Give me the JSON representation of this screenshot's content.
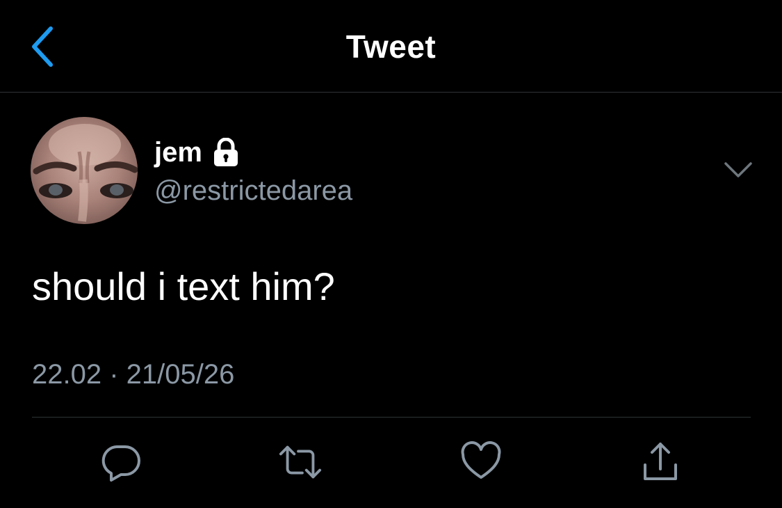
{
  "header": {
    "title": "Tweet",
    "back_icon": "chevron-left-icon"
  },
  "tweet": {
    "author": {
      "display_name": "jem",
      "handle": "@restrictedarea",
      "protected_icon": "lock-icon"
    },
    "text": "should i text him?",
    "timestamp": "22.02 · 21/05/26"
  },
  "actions": [
    {
      "name": "reply",
      "icon": "reply-icon"
    },
    {
      "name": "retweet",
      "icon": "retweet-icon"
    },
    {
      "name": "like",
      "icon": "heart-icon"
    },
    {
      "name": "share",
      "icon": "share-icon"
    }
  ],
  "colors": {
    "background": "#000000",
    "accent": "#1d9bf0",
    "primary_text": "#ffffff",
    "secondary_text": "#8b98a5",
    "divider": "#2f3336"
  }
}
